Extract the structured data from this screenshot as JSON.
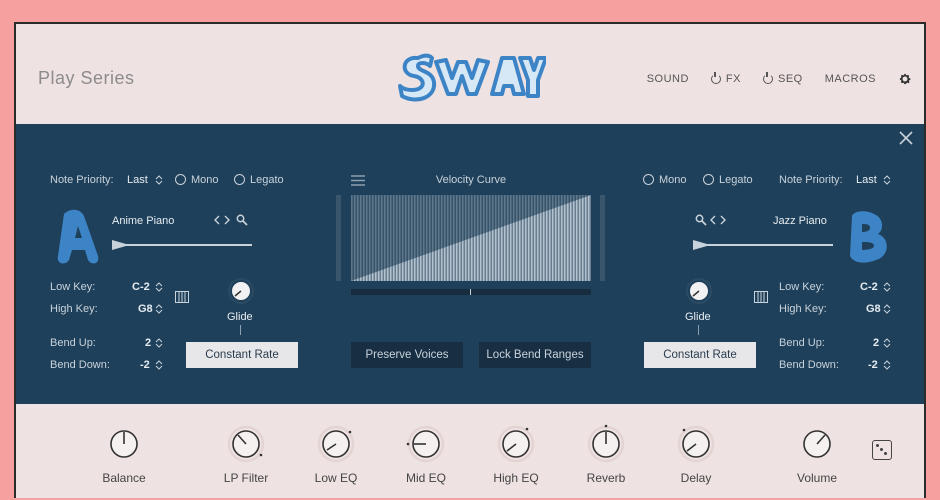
{
  "header": {
    "brand": "Play Series",
    "nav": [
      "SOUND",
      "FX",
      "SEQ",
      "MACROS"
    ]
  },
  "left": {
    "note_priority_label": "Note Priority:",
    "note_priority_value": "Last",
    "mono": "Mono",
    "legato": "Legato",
    "instrument": "Anime Piano",
    "low_key_label": "Low Key:",
    "low_key": "C-2",
    "high_key_label": "High Key:",
    "high_key": "G8",
    "glide": "Glide",
    "bend_up_label": "Bend Up:",
    "bend_up": "2",
    "bend_down_label": "Bend Down:",
    "bend_down": "-2",
    "rate_button": "Constant Rate"
  },
  "right": {
    "note_priority_label": "Note Priority:",
    "note_priority_value": "Last",
    "mono": "Mono",
    "legato": "Legato",
    "instrument": "Jazz Piano",
    "low_key_label": "Low Key:",
    "low_key": "C-2",
    "high_key_label": "High Key:",
    "high_key": "G8",
    "glide": "Glide",
    "bend_up_label": "Bend Up:",
    "bend_up": "2",
    "bend_down_label": "Bend Down:",
    "bend_down": "-2",
    "rate_button": "Constant Rate"
  },
  "center": {
    "velocity_title": "Velocity Curve",
    "preserve_voices": "Preserve Voices",
    "lock_bend": "Lock Bend Ranges"
  },
  "footer": {
    "knobs": [
      "Balance",
      "LP Filter",
      "Low EQ",
      "Mid EQ",
      "High EQ",
      "Reverb",
      "Delay",
      "Volume"
    ]
  },
  "colors": {
    "panel": "#1f405a",
    "accent_blue": "#3d84c6",
    "background": "#f7a0a0"
  }
}
